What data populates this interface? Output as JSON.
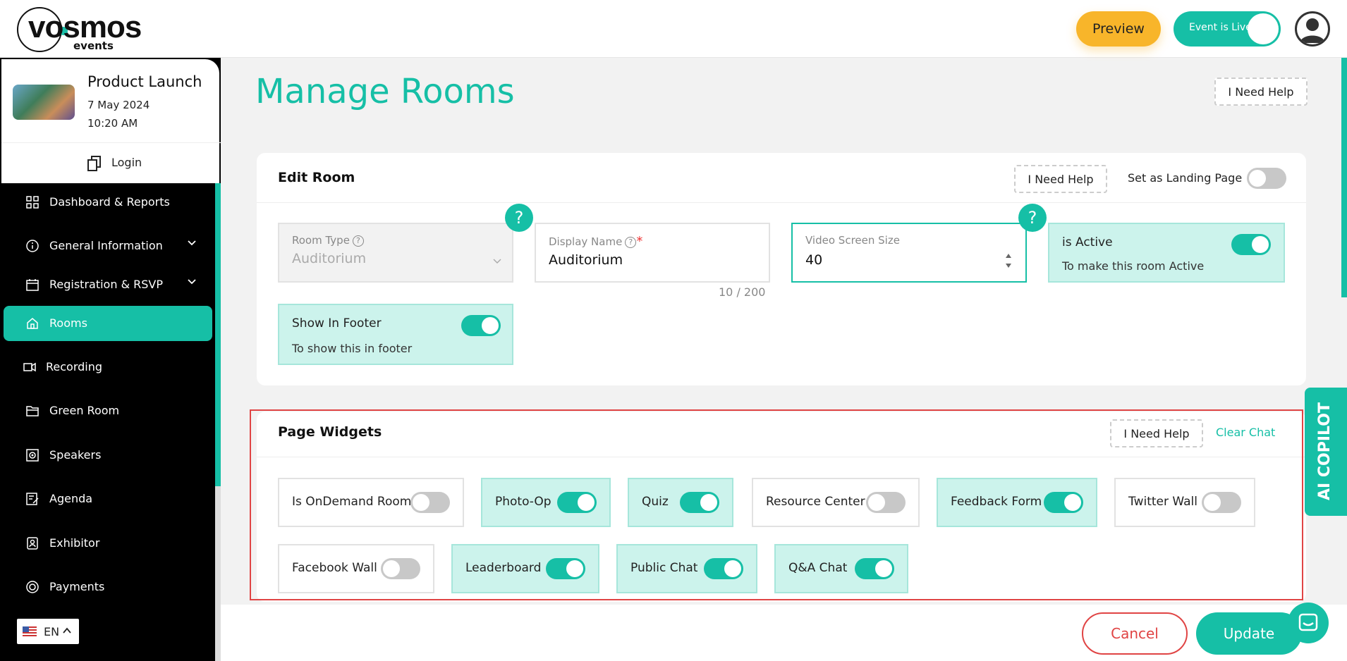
{
  "brand": {
    "name": "vosmos",
    "sub": "events",
    "accent": "#16bfa6"
  },
  "header": {
    "preview_label": "Preview",
    "live_label": "Event is Live"
  },
  "event": {
    "title": "Product Launch",
    "date": "7 May 2024",
    "time": "10:20 AM",
    "login_label": "Login"
  },
  "sidebar": {
    "items": [
      {
        "label": "Dashboard & Reports",
        "icon": "grid-icon"
      },
      {
        "label": "General Information",
        "icon": "info-icon",
        "expandable": true
      },
      {
        "label": "Registration & RSVP",
        "icon": "calendar-icon",
        "expandable": true
      },
      {
        "label": "Rooms",
        "icon": "home-icon",
        "active": true
      },
      {
        "label": "Recording",
        "icon": "video-icon"
      },
      {
        "label": "Green Room",
        "icon": "folder-icon"
      },
      {
        "label": "Speakers",
        "icon": "speaker-icon"
      },
      {
        "label": "Agenda",
        "icon": "edit-icon"
      },
      {
        "label": "Exhibitor",
        "icon": "badge-icon"
      },
      {
        "label": "Payments",
        "icon": "payment-icon"
      }
    ]
  },
  "language": {
    "code": "EN"
  },
  "page": {
    "title": "Manage Rooms",
    "help_label": "I Need Help"
  },
  "edit_room": {
    "title": "Edit Room",
    "help_label": "I Need Help",
    "landing_label": "Set as Landing Page",
    "landing_on": false,
    "room_type_label": "Room Type",
    "room_type_value": "Auditorium",
    "display_name_label": "Display Name",
    "display_name_value": "Auditorium",
    "display_name_count": "10 / 200",
    "video_size_label": "Video Screen Size",
    "video_size_value": "40",
    "active_label": "is Active",
    "active_desc": "To make this room Active",
    "active_on": true,
    "footer_label": "Show In Footer",
    "footer_desc": "To show this in footer",
    "footer_on": true,
    "help_glyph": "?"
  },
  "widgets": {
    "title": "Page Widgets",
    "help_label": "I Need Help",
    "clear_label": "Clear Chat",
    "items": [
      {
        "label": "Is OnDemand Room",
        "on": false
      },
      {
        "label": "Photo-Op",
        "on": true
      },
      {
        "label": "Quiz",
        "on": true
      },
      {
        "label": "Resource Center",
        "on": false
      },
      {
        "label": "Feedback Form",
        "on": true
      },
      {
        "label": "Twitter Wall",
        "on": false
      },
      {
        "label": "Facebook Wall",
        "on": false
      },
      {
        "label": "Leaderboard",
        "on": true
      },
      {
        "label": "Public Chat",
        "on": true
      },
      {
        "label": "Q&A Chat",
        "on": true
      }
    ]
  },
  "footer": {
    "cancel_label": "Cancel",
    "update_label": "Update"
  },
  "copilot": {
    "label": "AI COPILOT"
  }
}
